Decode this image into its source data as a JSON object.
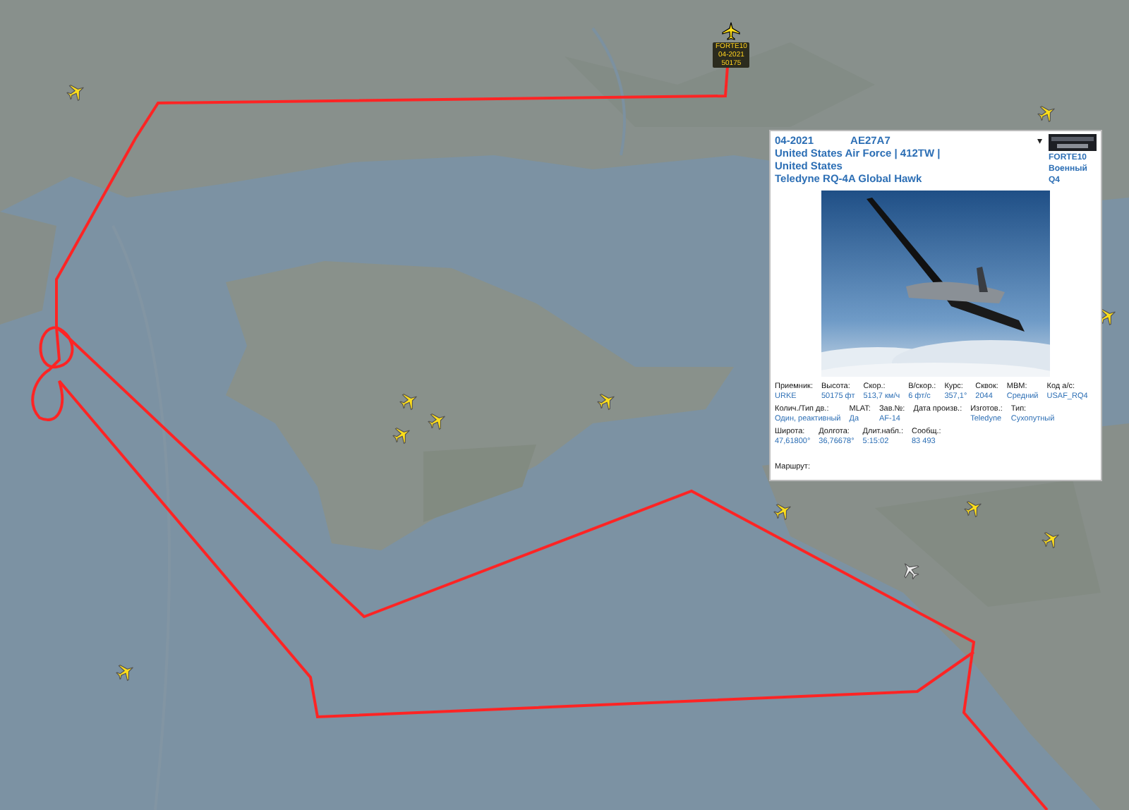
{
  "aircraft": [
    {
      "kind": "tracked",
      "label": [
        "FORTE10",
        "04-2021",
        "50175"
      ]
    },
    {
      "kind": "normal"
    },
    {
      "kind": "normal"
    },
    {
      "kind": "normal"
    },
    {
      "kind": "normal"
    },
    {
      "kind": "normal"
    },
    {
      "kind": "normal"
    },
    {
      "kind": "normal"
    },
    {
      "kind": "normal"
    },
    {
      "kind": "normal"
    },
    {
      "kind": "normal"
    },
    {
      "kind": "normal"
    },
    {
      "kind": "ground"
    }
  ],
  "popup": {
    "registration": "04-2021",
    "hex": "AE27A7",
    "caret": "▾",
    "operator": "United States Air Force | 412TW |",
    "country": "United States",
    "aircraft_type": "Teledyne RQ-4A Global Hawk",
    "callsign": "FORTE10",
    "category": "Военный",
    "type_code": "Q4",
    "field_rows": [
      [
        {
          "label": "Приемник:",
          "value": "URKE"
        },
        {
          "label": "Высота:",
          "value": "50175 фт"
        },
        {
          "label": "Скор.:",
          "value": "513,7 км/ч"
        },
        {
          "label": "В/скор.:",
          "value": "6 фт/с"
        },
        {
          "label": "Курс:",
          "value": "357,1°"
        },
        {
          "label": "Сквок:",
          "value": "2044"
        },
        {
          "label": "MВM:",
          "value": "Средний"
        },
        {
          "label": "Код а/с:",
          "value": "USAF_RQ4"
        }
      ],
      [
        {
          "label": "Колич./Тип дв.:",
          "value": "Один, реактивный"
        },
        {
          "label": "MLAT:",
          "value": "Да"
        },
        {
          "label": "Зав.№:",
          "value": "AF-14"
        },
        {
          "label": "Дата произв.:"
        },
        {
          "label": "Изготов.:",
          "value": "Teledyne"
        },
        {
          "label": "Тип:",
          "value": "Сухопутный"
        }
      ],
      [
        {
          "label": "Широта:",
          "value": "47,61800°"
        },
        {
          "label": "Долгота:",
          "value": "36,76678°"
        },
        {
          "label": "Длит.набл.:",
          "value": "5:15:02"
        },
        {
          "label": "Сообщ.:",
          "value": "83 493"
        }
      ]
    ],
    "route_label": "Маршрут:"
  }
}
